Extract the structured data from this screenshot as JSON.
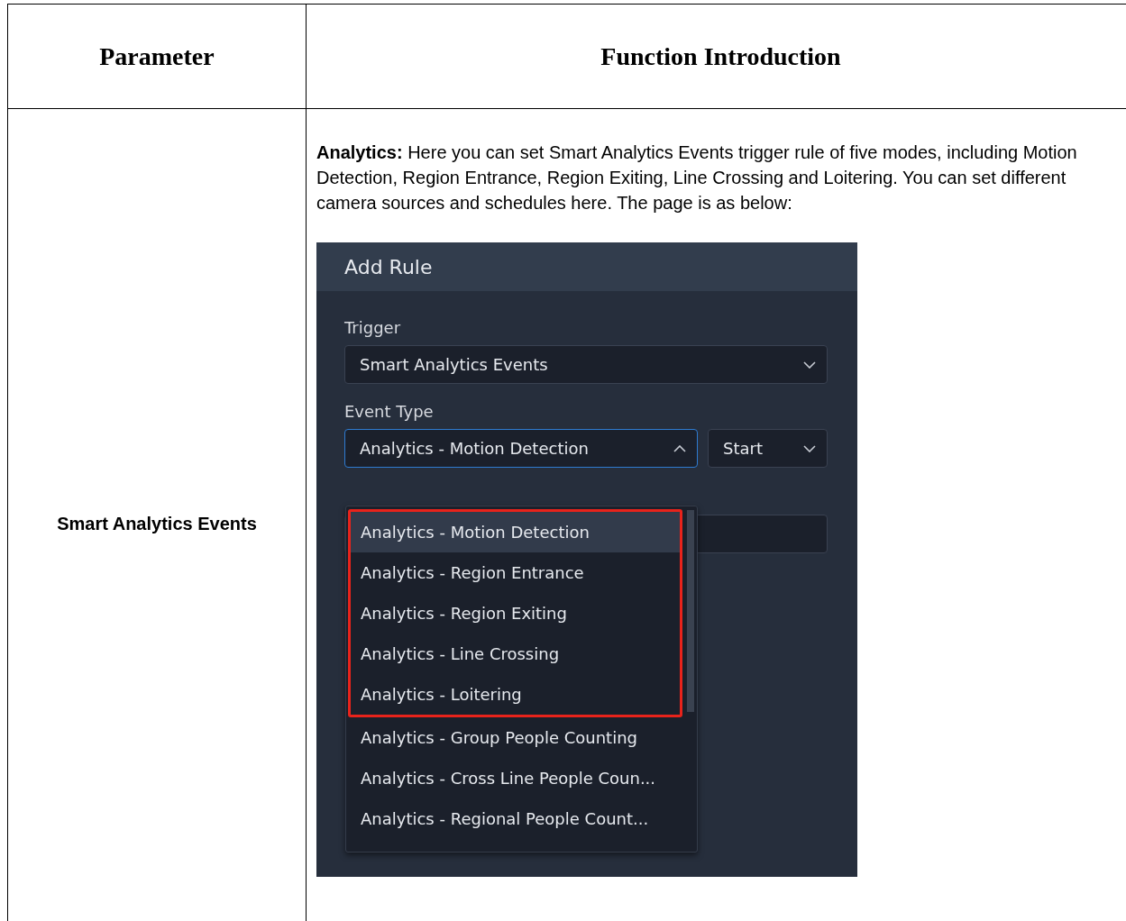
{
  "table": {
    "columns": [
      "Parameter",
      "Function Introduction"
    ],
    "rows": [
      {
        "parameter": "Smart Analytics Events",
        "description": "**Analytics:** Here you can set Smart Analytics Events trigger rule of five modes, including Motion Detection, Region Entrance, Region Exiting, Line Crossing and Loitering. You can set different camera sources and schedules here. The page is as below:",
        "screenshot": {
          "title": "Add Rule",
          "trigger": {
            "label": "Trigger",
            "value": "Smart Analytics Events"
          },
          "event_type": {
            "label": "Event Type",
            "value": "Analytics - Motion Detection",
            "expanded": true
          },
          "edge": {
            "value": "Start",
            "expanded": false
          },
          "options": [
            {
              "label": "Analytics - Motion Detection",
              "selected": true,
              "highlighted": true
            },
            {
              "label": "Analytics - Region Entrance",
              "selected": false,
              "highlighted": true
            },
            {
              "label": "Analytics - Region Exiting",
              "selected": false,
              "highlighted": true
            },
            {
              "label": "Analytics - Line Crossing",
              "selected": false,
              "highlighted": true
            },
            {
              "label": "Analytics - Loitering",
              "selected": false,
              "highlighted": true
            },
            {
              "label": "Analytics - Group People Counting",
              "selected": false,
              "highlighted": false
            },
            {
              "label": "Analytics - Cross Line People Coun...",
              "selected": false,
              "highlighted": false
            },
            {
              "label": "Analytics - Regional People Count...",
              "selected": false,
              "highlighted": false
            }
          ]
        }
      }
    ]
  }
}
